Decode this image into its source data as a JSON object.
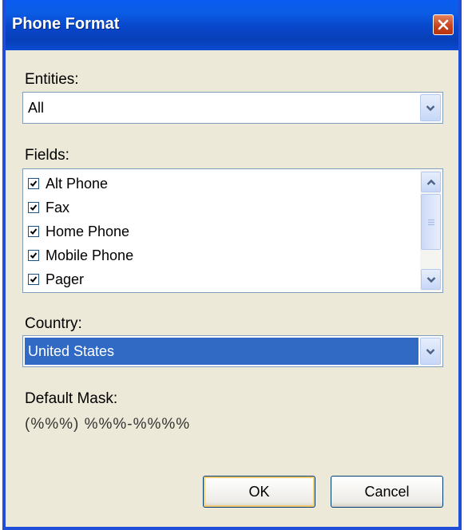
{
  "window": {
    "title": "Phone Format"
  },
  "entities": {
    "label": "Entities:",
    "value": "All"
  },
  "fields": {
    "label": "Fields:",
    "items": [
      {
        "label": "Alt Phone",
        "checked": true
      },
      {
        "label": "Fax",
        "checked": true
      },
      {
        "label": "Home Phone",
        "checked": true
      },
      {
        "label": "Mobile Phone",
        "checked": true
      },
      {
        "label": "Pager",
        "checked": true
      }
    ]
  },
  "country": {
    "label": "Country:",
    "value": "United States"
  },
  "mask": {
    "label": "Default Mask:",
    "value": "(%%%) %%%-%%%%"
  },
  "buttons": {
    "ok": "OK",
    "cancel": "Cancel"
  },
  "icons": {
    "close": "close-icon",
    "dropdown": "chevron-down-icon",
    "checkbox": "checkmark-icon",
    "scroll_up": "chevron-up-icon",
    "scroll_down": "chevron-down-icon",
    "scroll_thumb": "grip-icon"
  },
  "colors": {
    "titlebar": "#0846c9",
    "selection": "#316ac5",
    "close_button": "#c6411c",
    "dialog_background": "#ece9d8"
  }
}
